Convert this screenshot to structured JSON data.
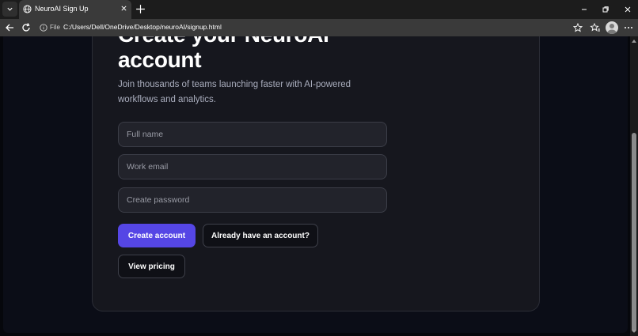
{
  "browser": {
    "tab_title": "NeuroAI Sign Up",
    "address_scheme_label": "File",
    "address_url": "C:/Users/Dell/OneDrive/Desktop/neuroAI/signup.html"
  },
  "page": {
    "heading_line1": "Create your NeuroAI",
    "heading_line2": "account",
    "subtitle": "Join thousands of teams launching faster with AI-powered workflows and analytics.",
    "fields": {
      "full_name_placeholder": "Full name",
      "email_placeholder": "Work email",
      "password_placeholder": "Create password"
    },
    "buttons": {
      "create_account": "Create account",
      "have_account": "Already have an account?",
      "view_pricing": "View pricing"
    }
  },
  "colors": {
    "accent": "#5546e5",
    "card_bg": "#16171e",
    "page_bg": "#0b0d17"
  }
}
